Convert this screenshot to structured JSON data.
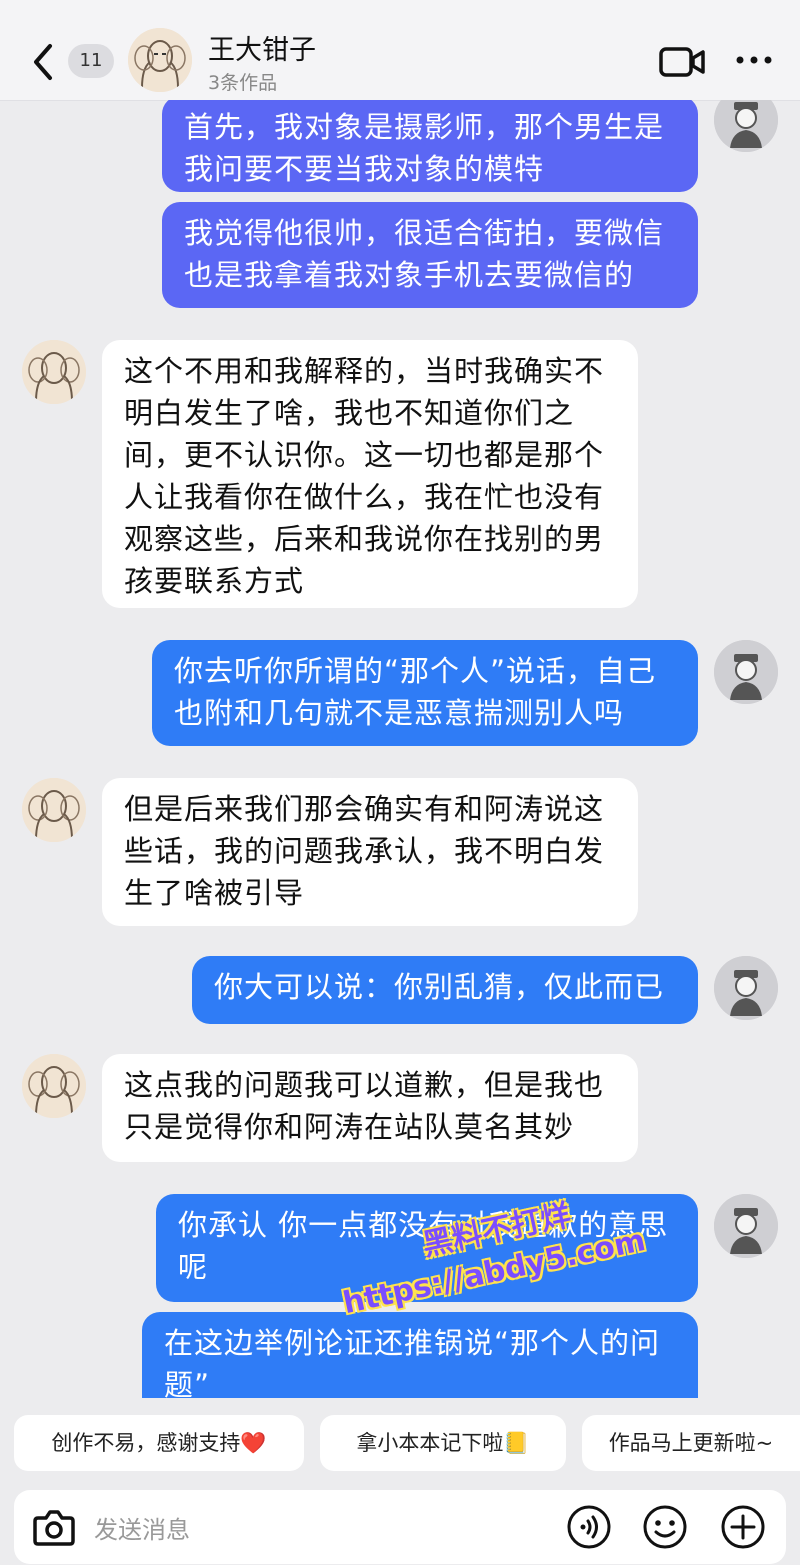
{
  "header": {
    "unread_count": "11",
    "contact_name": "王大钳子",
    "contact_sub": "3条作品",
    "icons": [
      "back-arrow-icon",
      "video-call-icon",
      "more-icon"
    ]
  },
  "messages": [
    {
      "side": "out",
      "lines": [
        "首先，我对象是摄影师，那个男生是",
        "我问要不要当我对象的模特"
      ]
    },
    {
      "side": "out",
      "lines": [
        "我觉得他很帅，很适合街拍，要微信",
        "也是我拿着我对象手机去要微信的"
      ]
    },
    {
      "side": "in",
      "lines": [
        "这个不用和我解释的，当时我确实不",
        "明白发生了啥，我也不知道你们之",
        "间，更不认识你。这一切也都是那个",
        "人让我看你在做什么，我在忙也没有",
        "观察这些，后来和我说你在找别的男",
        "孩要联系方式"
      ]
    },
    {
      "side": "out",
      "lines": [
        "你去听你所谓的“那个人”说话，自己",
        "也附和几句就不是恶意揣测别人吗"
      ]
    },
    {
      "side": "in",
      "lines": [
        "但是后来我们那会确实有和阿涛说这",
        "些话，我的问题我承认，我不明白发",
        "生了啥被引导"
      ]
    },
    {
      "side": "out",
      "lines": [
        "你大可以说：你别乱猜，仅此而已"
      ]
    },
    {
      "side": "in",
      "lines": [
        "这点我的问题我可以道歉，但是我也",
        "只是觉得你和阿涛在站队莫名其妙"
      ]
    },
    {
      "side": "out",
      "lines": [
        "你承认 你一点都没有对我道歉的意思",
        "呢"
      ]
    },
    {
      "side": "out",
      "lines": [
        "在这边举例论证还推锅说“那个人的问",
        "题”"
      ]
    }
  ],
  "watermark": {
    "line1": "黑料不打烊",
    "line2": "https://abdy5.com"
  },
  "quick_replies": [
    "创作不易，感谢支持❤️",
    "拿小本本记下啦📒",
    "作品马上更新啦~"
  ],
  "input": {
    "placeholder": "发送消息"
  },
  "colors": {
    "out_purple": "#5b67f4",
    "out_blue": "#2f7cf6",
    "bg": "#ececee"
  }
}
